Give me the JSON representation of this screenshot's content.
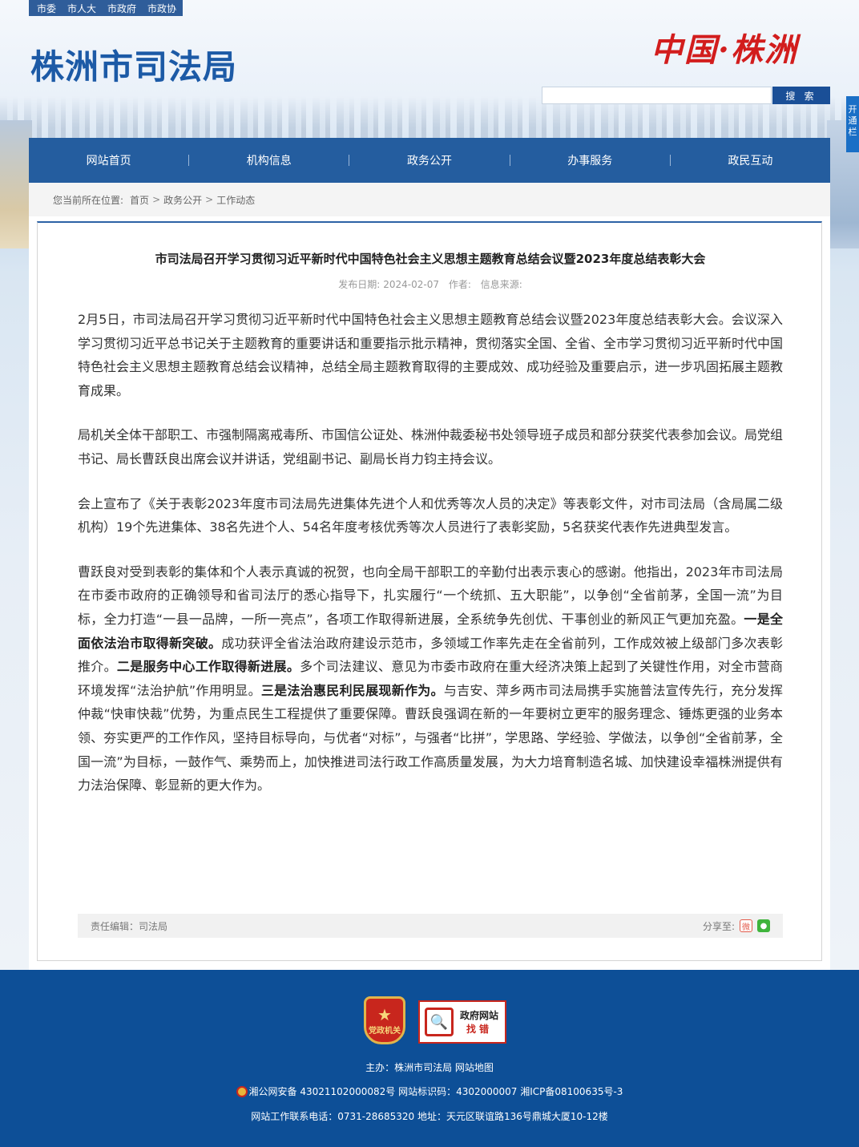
{
  "topbar": {
    "items": [
      "市委",
      "市人大",
      "市政府",
      "市政协"
    ]
  },
  "header": {
    "site_title": "株洲市司法局",
    "logo_text": "中国·株洲",
    "search_placeholder": "",
    "search_button": "搜 索",
    "side_tab": "开通栏"
  },
  "nav": {
    "items": [
      "网站首页",
      "机构信息",
      "政务公开",
      "办事服务",
      "政民互动"
    ]
  },
  "breadcrumb": {
    "label": "您当前所在位置:",
    "items": [
      "首页",
      "政务公开",
      "工作动态"
    ],
    "sep": ">"
  },
  "article": {
    "title": "市司法局召开学习贯彻习近平新时代中国特色社会主义思想主题教育总结会议暨2023年度总结表彰大会",
    "date_label": "发布日期:",
    "date": "2024-02-07",
    "author_label": "作者:",
    "source_label": "信息来源:",
    "p1": "2月5日，市司法局召开学习贯彻习近平新时代中国特色社会主义思想主题教育总结会议暨2023年度总结表彰大会。会议深入学习贯彻习近平总书记关于主题教育的重要讲话和重要指示批示精神，贯彻落实全国、全省、全市学习贯彻习近平新时代中国特色社会主义思想主题教育总结会议精神，总结全局主题教育取得的主要成效、成功经验及重要启示，进一步巩固拓展主题教育成果。",
    "p2": "局机关全体干部职工、市强制隔离戒毒所、市国信公证处、株洲仲裁委秘书处领导班子成员和部分获奖代表参加会议。局党组书记、局长曹跃良出席会议并讲话，党组副书记、副局长肖力钧主持会议。",
    "p3": "会上宣布了《关于表彰2023年度市司法局先进集体先进个人和优秀等次人员的决定》等表彰文件，对市司法局（含局属二级机构）19个先进集体、38名先进个人、54名年度考核优秀等次人员进行了表彰奖励，5名获奖代表作先进典型发言。",
    "p4_a": "曹跃良对受到表彰的集体和个人表示真诚的祝贺，也向全局干部职工的辛勤付出表示衷心的感谢。他指出，2023年市司法局在市委市政府的正确领导和省司法厅的悉心指导下，扎实履行“一个统抓、五大职能”，以争创“全省前茅，全国一流”为目标，全力打造“一县一品牌，一所一亮点”，各项工作取得新进展，全系统争先创优、干事创业的新风正气更加充盈。",
    "p4_b1": "一是全面依法治市取得新突破。",
    "p4_c": "成功获评全省法治政府建设示范市，多领域工作率先走在全省前列，工作成效被上级部门多次表彰推介。",
    "p4_b2": "二是服务中心工作取得新进展。",
    "p4_d": "多个司法建议、意见为市委市政府在重大经济决策上起到了关键性作用，对全市营商环境发挥“法治护航”作用明显。",
    "p4_b3": "三是法治惠民利民展现新作为。",
    "p4_e": "与吉安、萍乡两市司法局携手实施普法宣传先行，充分发挥仲裁“快审快裁”优势，为重点民生工程提供了重要保障。曹跃良强调在新的一年要树立更牢的服务理念、锤炼更强的业务本领、夯实更严的工作作风，坚持目标导向，与优者“对标”，与强者“比拼”，学思路、学经验、学做法，以争创“全省前茅，全国一流”为目标，一鼓作气、乘势而上，加快推进司法行政工作高质量发展，为大力培育制造名城、加快建设幸福株洲提供有力法治保障、彰显新的更大作为。",
    "editor": "责任编辑：司法局",
    "share_label": "分享至:"
  },
  "footer": {
    "badge_text": "党政机关",
    "findbug_line1": "政府网站",
    "findbug_line2": "找错",
    "line1": "主办：株洲市司法局 网站地图",
    "line2": "湘公网安备 43021102000082号 网站标识码：4302000007 湘ICP备08100635号-3",
    "line3": "网站工作联系电话：0731-28685320 地址：天元区联谊路136号鼎城大厦10-12楼"
  }
}
